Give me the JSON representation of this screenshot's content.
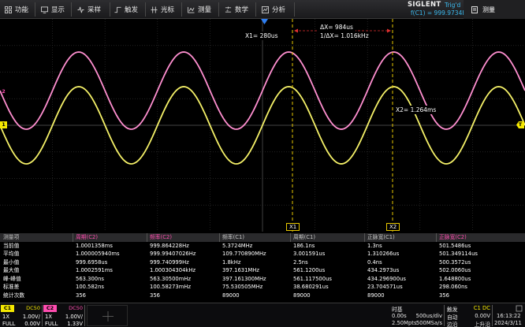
{
  "toolbar": {
    "items": [
      {
        "label": "功能",
        "icon": "grid-icon"
      },
      {
        "label": "显示",
        "icon": "display-icon"
      },
      {
        "label": "采样",
        "icon": "acquire-icon"
      },
      {
        "label": "触发",
        "icon": "trigger-icon"
      },
      {
        "label": "光标",
        "icon": "cursor-icon"
      },
      {
        "label": "测量",
        "icon": "measure-icon"
      },
      {
        "label": "数学",
        "icon": "math-icon"
      },
      {
        "label": "分析",
        "icon": "analysis-icon"
      }
    ],
    "brand": "SIGLENT",
    "trigger_state": "Trig'd",
    "frequency_readout": "f(C1) = 999.9734Hz",
    "measure_button": "测量"
  },
  "cursors": {
    "x1_label": "X1= 280us",
    "delta_x": "ΔX= 984us",
    "inverse_delta_x": "1/ΔX= 1.016kHz",
    "x2_label": "X2= 1.264ms",
    "x1_marker": "X1",
    "x2_marker": "X2"
  },
  "channel_markers": {
    "c1": "1",
    "c2": "2",
    "trigger_level": "T"
  },
  "waveforms": {
    "c1_color": "#f5f168",
    "c2_color": "#ff8fd0",
    "cursor_color": "#e8c800",
    "trigger_color": "#2f7ef0"
  },
  "measurements": {
    "headers": [
      "测量项",
      "周期(C2)",
      "频率(C2)",
      "频率(C1)",
      "周期(C1)",
      "正脉宽(C1)",
      "正脉宽(C2)"
    ],
    "header_colors": [
      "#c8c8c8",
      "#ff4db0",
      "#ff4db0",
      "#c8c8c8",
      "#c8c8c8",
      "#c8c8c8",
      "#ff4db0"
    ],
    "rows": [
      [
        "当前值",
        "1.0001358ms",
        "999.864228Hz",
        "5.3724MHz",
        "186.1ns",
        "1.3ns",
        "501.5486us"
      ],
      [
        "平均值",
        "1.000005940ms",
        "999.99407026Hz",
        "109.770890MHz",
        "3.001591us",
        "1.310266us",
        "501.349114us"
      ],
      [
        "最小值",
        "999.6958us",
        "999.740999Hz",
        "1.8kHz",
        "2.5ns",
        "0.4ns",
        "500.3572us"
      ],
      [
        "最大值",
        "1.0002591ms",
        "1.000304304kHz",
        "397.1631MHz",
        "561.1200us",
        "434.2973us",
        "502.0060us"
      ],
      [
        "峰-峰值",
        "563.300ns",
        "563.30500mHz",
        "397.161300MHz",
        "561.117500us",
        "434.296900us",
        "1.648800us"
      ],
      [
        "标准差",
        "100.582ns",
        "100.58273mHz",
        "75.530505MHz",
        "38.680291us",
        "23.704571us",
        "298.060ns"
      ],
      [
        "统计次数",
        "356",
        "356",
        "89000",
        "89000",
        "89000",
        "356"
      ]
    ]
  },
  "channels": {
    "c1": {
      "tag": "C1",
      "coupling": "DC50",
      "probe": "1X",
      "scale": "1.00V/",
      "bw": "FULL",
      "offset": "0.00V",
      "color": "#f5e800"
    },
    "c2": {
      "tag": "C2",
      "coupling": "DC50",
      "probe": "1X",
      "scale": "1.00V/",
      "bw": "FULL",
      "offset": "1.33V",
      "color": "#ff4db0"
    }
  },
  "timebase": {
    "title": "时基",
    "position": "0.00s",
    "scale": "500us/div",
    "points": "2.50Mpts",
    "sample_rate": "500MSa/s"
  },
  "trigger": {
    "title": "触发",
    "source": "C1 DC",
    "mode": "自动",
    "level": "0.00V",
    "type": "边沿",
    "slope": "上升沿"
  },
  "clock": {
    "time": "16:13:22",
    "date": "2024/3/11"
  }
}
